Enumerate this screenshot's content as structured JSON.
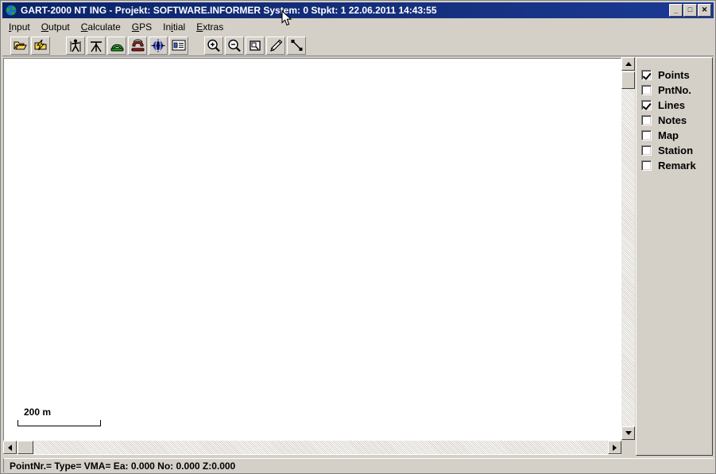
{
  "window": {
    "title": "GART-2000 NT ING - Projekt: SOFTWARE.INFORMER System: 0  Stpkt: 1 22.06.2011 14:43:55",
    "app_icon": "globe-icon",
    "controls": {
      "minimize": "_",
      "maximize": "□",
      "close": "✕"
    },
    "colors": {
      "titlebar_active": "#0a246a",
      "face": "#d4d0c8",
      "canvas": "#ffffff",
      "text": "#000000"
    }
  },
  "menubar": {
    "items": [
      {
        "label": "Input",
        "pre": "",
        "accel": "I",
        "post": "nput"
      },
      {
        "label": "Output",
        "pre": "",
        "accel": "O",
        "post": "utput"
      },
      {
        "label": "Calculate",
        "pre": "",
        "accel": "C",
        "post": "alculate"
      },
      {
        "label": "GPS",
        "pre": "",
        "accel": "G",
        "post": "PS"
      },
      {
        "label": "Initial",
        "pre": "In",
        "accel": "i",
        "post": "tial"
      },
      {
        "label": "Extras",
        "pre": "",
        "accel": "E",
        "post": "xtras"
      }
    ]
  },
  "toolbar": {
    "groups": [
      {
        "buttons": [
          {
            "name": "open-project-button",
            "icon": "open-folder-icon",
            "tip": "Open"
          },
          {
            "name": "import-data-button",
            "icon": "folder-lightning-icon",
            "tip": "Import"
          }
        ]
      },
      {
        "buttons": [
          {
            "name": "surveyor-button",
            "icon": "surveyor-person-icon",
            "tip": "Surveyor"
          },
          {
            "name": "tripod-button",
            "icon": "tripod-icon",
            "tip": "Tripod"
          },
          {
            "name": "connect-button",
            "icon": "green-telephone-icon",
            "tip": "Connect"
          },
          {
            "name": "disconnect-button",
            "icon": "red-telephone-icon",
            "tip": "Disconnect"
          },
          {
            "name": "target-button",
            "icon": "crosshair-globe-icon",
            "tip": "Target"
          },
          {
            "name": "list-button",
            "icon": "details-list-icon",
            "tip": "List"
          }
        ]
      },
      {
        "buttons": [
          {
            "name": "zoom-in-button",
            "icon": "magnifier-plus-icon",
            "tip": "Zoom In"
          },
          {
            "name": "zoom-out-button",
            "icon": "magnifier-minus-icon",
            "tip": "Zoom Out"
          },
          {
            "name": "zoom-window-button",
            "icon": "zoom-window-icon",
            "tip": "Zoom Window"
          },
          {
            "name": "pencil-button",
            "icon": "pencil-icon",
            "tip": "Draw"
          },
          {
            "name": "line-button",
            "icon": "line-icon",
            "tip": "Line"
          }
        ]
      }
    ]
  },
  "canvas": {
    "scalebar": {
      "label": "200 m"
    },
    "vertical_scrollbar": {
      "up": "scroll-up-arrow",
      "down": "scroll-down-arrow"
    },
    "horizontal_scrollbar": {
      "left": "scroll-left-arrow",
      "right": "scroll-right-arrow"
    }
  },
  "layer_panel": {
    "items": [
      {
        "label": "Points",
        "checked": true,
        "name": "layer-checkbox-points"
      },
      {
        "label": "PntNo.",
        "checked": false,
        "name": "layer-checkbox-pntno"
      },
      {
        "label": "Lines",
        "checked": true,
        "name": "layer-checkbox-lines"
      },
      {
        "label": "Notes",
        "checked": false,
        "name": "layer-checkbox-notes"
      },
      {
        "label": "Map",
        "checked": false,
        "name": "layer-checkbox-map"
      },
      {
        "label": "Station",
        "checked": false,
        "name": "layer-checkbox-station"
      },
      {
        "label": "Remark",
        "checked": false,
        "name": "layer-checkbox-remark"
      }
    ]
  },
  "statusbar": {
    "text": "PointNr.=  Type=  VMA=  Ea: 0.000 No: 0.000 Z:0.000",
    "point_nr": "",
    "type": "",
    "vma": "",
    "ea": "0.000",
    "no": "0.000",
    "z": "0.000"
  }
}
